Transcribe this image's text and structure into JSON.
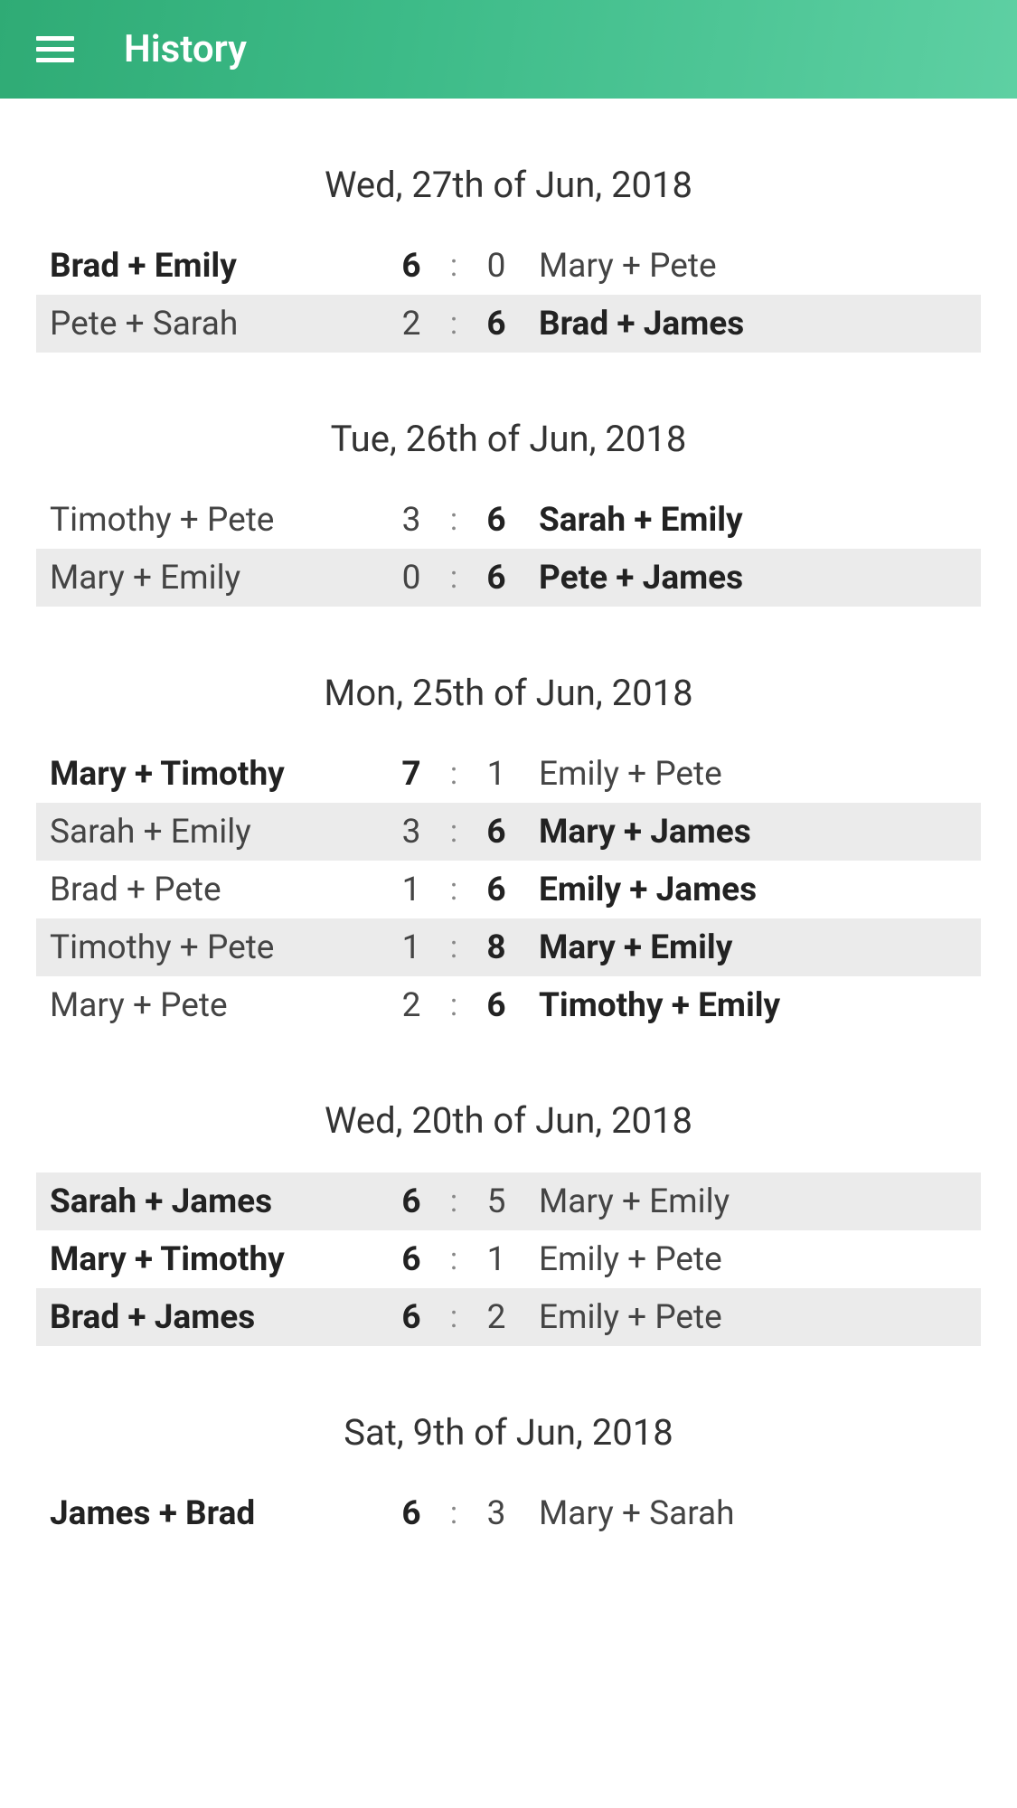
{
  "header": {
    "title": "History"
  },
  "days": [
    {
      "date": "Wed, 27th of Jun, 2018",
      "start_alt": false,
      "matches": [
        {
          "team1": "Brad + Emily",
          "score1": "6",
          "score2": "0",
          "team2": "Mary + Pete",
          "winner": 1
        },
        {
          "team1": "Pete + Sarah",
          "score1": "2",
          "score2": "6",
          "team2": "Brad + James",
          "winner": 2
        }
      ]
    },
    {
      "date": "Tue, 26th of Jun, 2018",
      "start_alt": false,
      "matches": [
        {
          "team1": "Timothy + Pete",
          "score1": "3",
          "score2": "6",
          "team2": "Sarah + Emily",
          "winner": 2
        },
        {
          "team1": "Mary + Emily",
          "score1": "0",
          "score2": "6",
          "team2": "Pete + James",
          "winner": 2
        }
      ]
    },
    {
      "date": "Mon, 25th of Jun, 2018",
      "start_alt": false,
      "matches": [
        {
          "team1": "Mary + Timothy",
          "score1": "7",
          "score2": "1",
          "team2": "Emily + Pete",
          "winner": 1
        },
        {
          "team1": "Sarah + Emily",
          "score1": "3",
          "score2": "6",
          "team2": "Mary + James",
          "winner": 2
        },
        {
          "team1": "Brad + Pete",
          "score1": "1",
          "score2": "6",
          "team2": "Emily + James",
          "winner": 2
        },
        {
          "team1": "Timothy + Pete",
          "score1": "1",
          "score2": "8",
          "team2": "Mary + Emily",
          "winner": 2
        },
        {
          "team1": "Mary + Pete",
          "score1": "2",
          "score2": "6",
          "team2": "Timothy + Emily",
          "winner": 2
        }
      ]
    },
    {
      "date": "Wed, 20th of Jun, 2018",
      "start_alt": true,
      "matches": [
        {
          "team1": "Sarah + James",
          "score1": "6",
          "score2": "5",
          "team2": "Mary + Emily",
          "winner": 1
        },
        {
          "team1": "Mary + Timothy",
          "score1": "6",
          "score2": "1",
          "team2": "Emily + Pete",
          "winner": 1
        },
        {
          "team1": "Brad + James",
          "score1": "6",
          "score2": "2",
          "team2": "Emily + Pete",
          "winner": 1
        }
      ]
    },
    {
      "date": "Sat, 9th of Jun, 2018",
      "start_alt": false,
      "matches": [
        {
          "team1": "James + Brad",
          "score1": "6",
          "score2": "3",
          "team2": "Mary + Sarah",
          "winner": 1
        }
      ]
    }
  ]
}
